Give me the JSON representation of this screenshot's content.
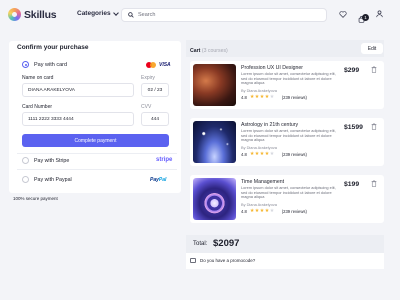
{
  "header": {
    "logo": "Skillus",
    "categories_label": "Categories",
    "search_placeholder": "Search",
    "cart_count": "1"
  },
  "checkout": {
    "title": "Confirm your purchase",
    "pay_card_label": "Pay with card",
    "visa_label": "VISA",
    "name_label": "Name on card",
    "name_value": "DIANA ARAKELYOVA",
    "expiry_label": "Expiry",
    "expiry_value": "02 / 23",
    "number_label": "Card Number",
    "number_value": "1111 2222 3333 4444",
    "cvv_label": "CVV",
    "cvv_value": "444",
    "pay_button": "Complete payment",
    "stripe_label": "Pay with Stripe",
    "stripe_logo": "stripe",
    "paypal_label": "Pay with Paypal",
    "paypal_logo_a": "Pay",
    "paypal_logo_b": "Pal",
    "secure_text": "100% secure payment"
  },
  "cart": {
    "title": "Cart",
    "count_text": "(3 courses)",
    "edit_label": "Edit",
    "items": [
      {
        "title": "Profession UX UI Designer",
        "desc": "Lorem ipsum dolor sit amet, consectetur adipiscing elit, sed do eiusmod tempor incididunt ut labore et dolore magna aliqua",
        "author": "By Diana Arakelyova",
        "rating": "4.8",
        "stars_filled": 4,
        "reviews": "(239 reviews)",
        "price": "$299"
      },
      {
        "title": "Astrology in 21th century",
        "desc": "Lorem ipsum dolor sit amet, consectetur adipiscing elit, sed do eiusmod tempor incididunt ut labore et dolore magna aliqua",
        "author": "By Diana Arakelyova",
        "rating": "4.8",
        "stars_filled": 4,
        "reviews": "(239 reviews)",
        "price": "$1599"
      },
      {
        "title": "Time Management",
        "desc": "Lorem ipsum dolor sit amet, consectetur adipiscing elit, sed do eiusmod tempor incididunt ut labore et dolore magna aliqua",
        "author": "By Diana Arakelyova",
        "rating": "4.8",
        "stars_filled": 4,
        "reviews": "(239 reviews)",
        "price": "$199"
      }
    ],
    "total_label": "Total:",
    "total_value": "$2097",
    "promo_text": "Do you have a promocode?"
  },
  "colors": {
    "accent": "#5b62f0",
    "background": "#f3f4f8",
    "star": "#f5b42a"
  }
}
